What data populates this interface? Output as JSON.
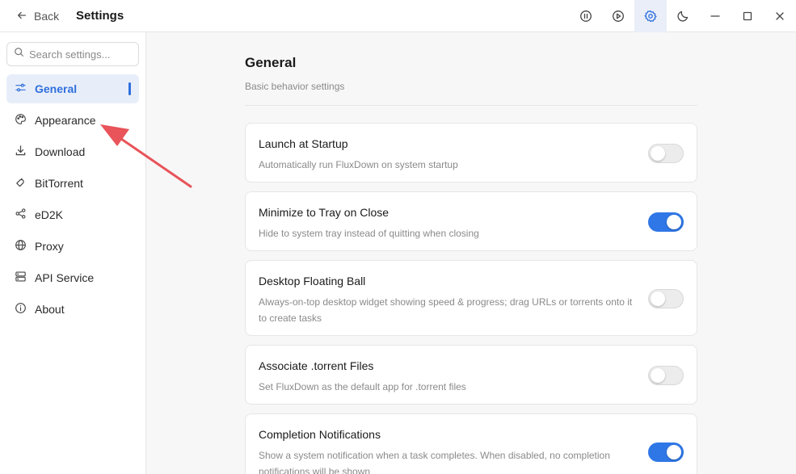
{
  "titlebar": {
    "back_label": "Back",
    "title": "Settings",
    "icons": [
      "pause-icon",
      "play-icon",
      "gear-icon",
      "moon-icon",
      "minimize-icon",
      "maximize-icon",
      "close-icon"
    ]
  },
  "sidebar": {
    "search_placeholder": "Search settings...",
    "items": [
      {
        "label": "General",
        "icon": "sliders-icon",
        "active": true
      },
      {
        "label": "Appearance",
        "icon": "palette-icon",
        "active": false
      },
      {
        "label": "Download",
        "icon": "download-icon",
        "active": false
      },
      {
        "label": "BitTorrent",
        "icon": "magnet-icon",
        "active": false
      },
      {
        "label": "eD2K",
        "icon": "share-icon",
        "active": false
      },
      {
        "label": "Proxy",
        "icon": "globe-icon",
        "active": false
      },
      {
        "label": "API Service",
        "icon": "server-icon",
        "active": false
      },
      {
        "label": "About",
        "icon": "info-icon",
        "active": false
      }
    ]
  },
  "main": {
    "title": "General",
    "subtitle": "Basic behavior settings",
    "settings": [
      {
        "title": "Launch at Startup",
        "desc": "Automatically run FluxDown on system startup",
        "enabled": false
      },
      {
        "title": "Minimize to Tray on Close",
        "desc": "Hide to system tray instead of quitting when closing",
        "enabled": true
      },
      {
        "title": "Desktop Floating Ball",
        "desc": "Always-on-top desktop widget showing speed & progress; drag URLs or torrents onto it to create tasks",
        "enabled": false
      },
      {
        "title": "Associate .torrent Files",
        "desc": "Set FluxDown as the default app for .torrent files",
        "enabled": false
      },
      {
        "title": "Completion Notifications",
        "desc": "Show a system notification when a task completes. When disabled, no completion notifications will be shown",
        "enabled": true
      }
    ]
  },
  "colors": {
    "accent": "#2f6fdd",
    "toggle_on": "#2f77e6",
    "annotation_arrow": "#e8545a"
  }
}
